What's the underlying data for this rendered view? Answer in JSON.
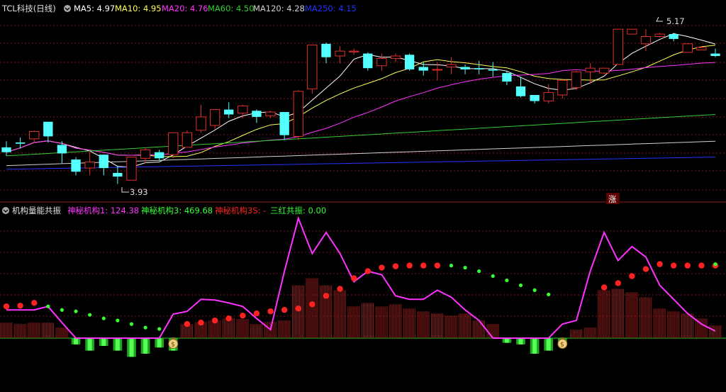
{
  "colors": {
    "bg": "#000000",
    "up": "#e0302c",
    "down": "#54ffff",
    "grid": "#7a1a1a",
    "ma5": "#ffffff",
    "ma10": "#ffff55",
    "ma20": "#ff33ff",
    "ma60": "#33cc33",
    "ma120": "#d0d0d0",
    "ma250": "#2233ff",
    "series1": "#ff33ff",
    "series3": "#33ff33",
    "series3S": "#ff2222",
    "resonance": "#33ff33",
    "baseline": "#22cc22"
  },
  "header": {
    "title": "TCL科技(日线)",
    "ma5": "MA5: 4.97",
    "ma10": "MA10: 4.95",
    "ma20": "MA20: 4.76",
    "ma60": "MA60: 4.50",
    "ma120": "MA120: 4.28",
    "ma250": "MA250: 4.15",
    "high_note": "5.17",
    "low_note": "3.93",
    "limit_badge": "涨"
  },
  "indicator": {
    "title": "机构量能共振",
    "s1": "神秘机构1: 124.38",
    "s3": "神秘机构3: 469.68",
    "s3s": "神秘机构3S: -",
    "res": "三红共振: 0.00"
  },
  "chart_data": [
    {
      "type": "candlestick",
      "title": "TCL科技(日线)",
      "note": "OHLC values are estimated from the price chart; two annotated extremes: high 5.17, low 3.93",
      "candles": [
        [
          4.23,
          4.28,
          4.19,
          4.16
        ],
        [
          4.27,
          4.31,
          4.26,
          4.22
        ],
        [
          4.3,
          4.37,
          4.36,
          4.27
        ],
        [
          4.44,
          4.44,
          4.32,
          4.27
        ],
        [
          4.25,
          4.28,
          4.18,
          4.1
        ],
        [
          4.13,
          4.15,
          4.03,
          4.0
        ],
        [
          4.06,
          4.2,
          4.11,
          4.0
        ],
        [
          4.17,
          4.17,
          4.06,
          4.0
        ],
        [
          4.02,
          4.08,
          3.99,
          3.93
        ],
        [
          3.96,
          4.13,
          4.15,
          3.96
        ],
        [
          4.14,
          4.23,
          4.21,
          4.1
        ],
        [
          4.19,
          4.21,
          4.14,
          4.12
        ],
        [
          4.17,
          4.34,
          4.35,
          4.14
        ],
        [
          4.23,
          4.37,
          4.35,
          4.24
        ],
        [
          4.37,
          4.58,
          4.48,
          4.35
        ],
        [
          4.41,
          4.54,
          4.54,
          4.38
        ],
        [
          4.54,
          4.6,
          4.5,
          4.47
        ],
        [
          4.51,
          4.58,
          4.57,
          4.47
        ],
        [
          4.53,
          4.54,
          4.48,
          4.43
        ],
        [
          4.49,
          4.53,
          4.52,
          4.47
        ],
        [
          4.52,
          4.52,
          4.33,
          4.29
        ],
        [
          4.32,
          4.7,
          4.69,
          4.29
        ],
        [
          4.71,
          5.02,
          5.07,
          4.67
        ],
        [
          5.08,
          5.09,
          4.97,
          4.92
        ],
        [
          4.98,
          5.06,
          5.02,
          4.92
        ],
        [
          5.02,
          5.04,
          5.02,
          4.99
        ],
        [
          5.0,
          5.01,
          4.88,
          4.86
        ],
        [
          4.9,
          5.0,
          4.96,
          4.86
        ],
        [
          4.96,
          5.0,
          4.98,
          4.93
        ],
        [
          4.99,
          5.0,
          4.87,
          4.86
        ],
        [
          4.89,
          4.93,
          4.86,
          4.82
        ],
        [
          4.87,
          4.93,
          4.87,
          4.78
        ],
        [
          4.89,
          4.97,
          4.91,
          4.83
        ],
        [
          4.89,
          4.91,
          4.87,
          4.83
        ],
        [
          4.88,
          4.94,
          4.87,
          4.83
        ],
        [
          4.87,
          4.93,
          4.86,
          4.81
        ],
        [
          4.84,
          4.86,
          4.77,
          4.74
        ],
        [
          4.73,
          4.81,
          4.65,
          4.64
        ],
        [
          4.66,
          4.66,
          4.61,
          4.59
        ],
        [
          4.61,
          4.75,
          4.68,
          4.59
        ],
        [
          4.66,
          4.76,
          4.78,
          4.63
        ],
        [
          4.72,
          4.86,
          4.85,
          4.7
        ],
        [
          4.85,
          4.92,
          4.88,
          4.75
        ],
        [
          4.84,
          4.87,
          4.88,
          4.83
        ],
        [
          4.91,
          5.08,
          5.2,
          4.91
        ],
        [
          5.16,
          5.09,
          5.2,
          5.09
        ],
        [
          5.08,
          5.2,
          5.14,
          5.02
        ],
        [
          5.14,
          5.17,
          5.16,
          5.13
        ],
        [
          5.16,
          5.17,
          5.12,
          5.1
        ],
        [
          5.01,
          5.08,
          5.08,
          5.01
        ],
        [
          5.03,
          5.06,
          5.05,
          5.03
        ],
        [
          5.0,
          5.04,
          4.98,
          4.97
        ]
      ],
      "candle_fields": [
        "open",
        "high",
        "close",
        "low"
      ],
      "series": [
        {
          "name": "MA5",
          "last": 4.97
        },
        {
          "name": "MA10",
          "last": 4.95
        },
        {
          "name": "MA20",
          "last": 4.76
        },
        {
          "name": "MA60",
          "last": 4.5
        },
        {
          "name": "MA120",
          "last": 4.28
        },
        {
          "name": "MA250",
          "last": 4.15
        }
      ],
      "ylim": [
        3.88,
        5.3
      ]
    },
    {
      "type": "bar+line+scatter",
      "title": "机构量能共振",
      "note": "values estimated from pixel heights; same x index as candles",
      "series": [
        {
          "name": "神秘机构1",
          "type": "line",
          "last": 124.38,
          "values": [
            40,
            40,
            40,
            45,
            22,
            0,
            0,
            0,
            0,
            0,
            0,
            0,
            34,
            38,
            55,
            54,
            50,
            45,
            28,
            12,
            95,
            170,
            120,
            150,
            120,
            80,
            95,
            90,
            60,
            55,
            55,
            68,
            58,
            40,
            25,
            0,
            0,
            0,
            0,
            0,
            20,
            25,
            95,
            150,
            110,
            130,
            115,
            75,
            55,
            35,
            20,
            10
          ]
        },
        {
          "name": "神秘机构3",
          "type": "bar",
          "last": 469.68,
          "values": [
            22,
            20,
            22,
            22,
            15,
            -4,
            -8,
            -5,
            -8,
            -12,
            -10,
            -6,
            -8,
            20,
            23,
            25,
            28,
            27,
            20,
            23,
            25,
            75,
            85,
            75,
            68,
            45,
            50,
            45,
            48,
            42,
            38,
            35,
            32,
            35,
            25,
            20,
            -3,
            -4,
            -10,
            -8,
            -2,
            12,
            15,
            68,
            70,
            65,
            58,
            42,
            38,
            35,
            28,
            18
          ]
        },
        {
          "name": "神秘机构3S",
          "type": "dot",
          "color": "red",
          "values": [
            45,
            46,
            50,
            null,
            null,
            null,
            null,
            null,
            null,
            null,
            null,
            null,
            null,
            20,
            22,
            25,
            28,
            32,
            35,
            38,
            40,
            42,
            48,
            60,
            70,
            85,
            95,
            100,
            102,
            103,
            103,
            103,
            null,
            null,
            null,
            null,
            null,
            null,
            null,
            null,
            null,
            null,
            null,
            72,
            78,
            88,
            98,
            105,
            103,
            103,
            103,
            103
          ]
        },
        {
          "name": "三红共振",
          "type": "dot",
          "color": "green",
          "last": 0.0,
          "values": [
            null,
            null,
            null,
            45,
            40,
            38,
            33,
            28,
            25,
            20,
            15,
            13,
            null,
            null,
            null,
            null,
            null,
            null,
            null,
            null,
            null,
            null,
            null,
            null,
            null,
            null,
            null,
            null,
            null,
            null,
            null,
            null,
            103,
            100,
            95,
            88,
            82,
            75,
            68,
            62,
            null,
            null,
            null,
            null,
            null,
            null,
            null,
            null,
            null,
            null,
            null,
            105
          ]
        }
      ],
      "markers": [
        {
          "type": "money-bag",
          "index": 12
        },
        {
          "type": "money-bag",
          "index": 40
        }
      ],
      "ylim": [
        -30,
        170
      ]
    }
  ]
}
